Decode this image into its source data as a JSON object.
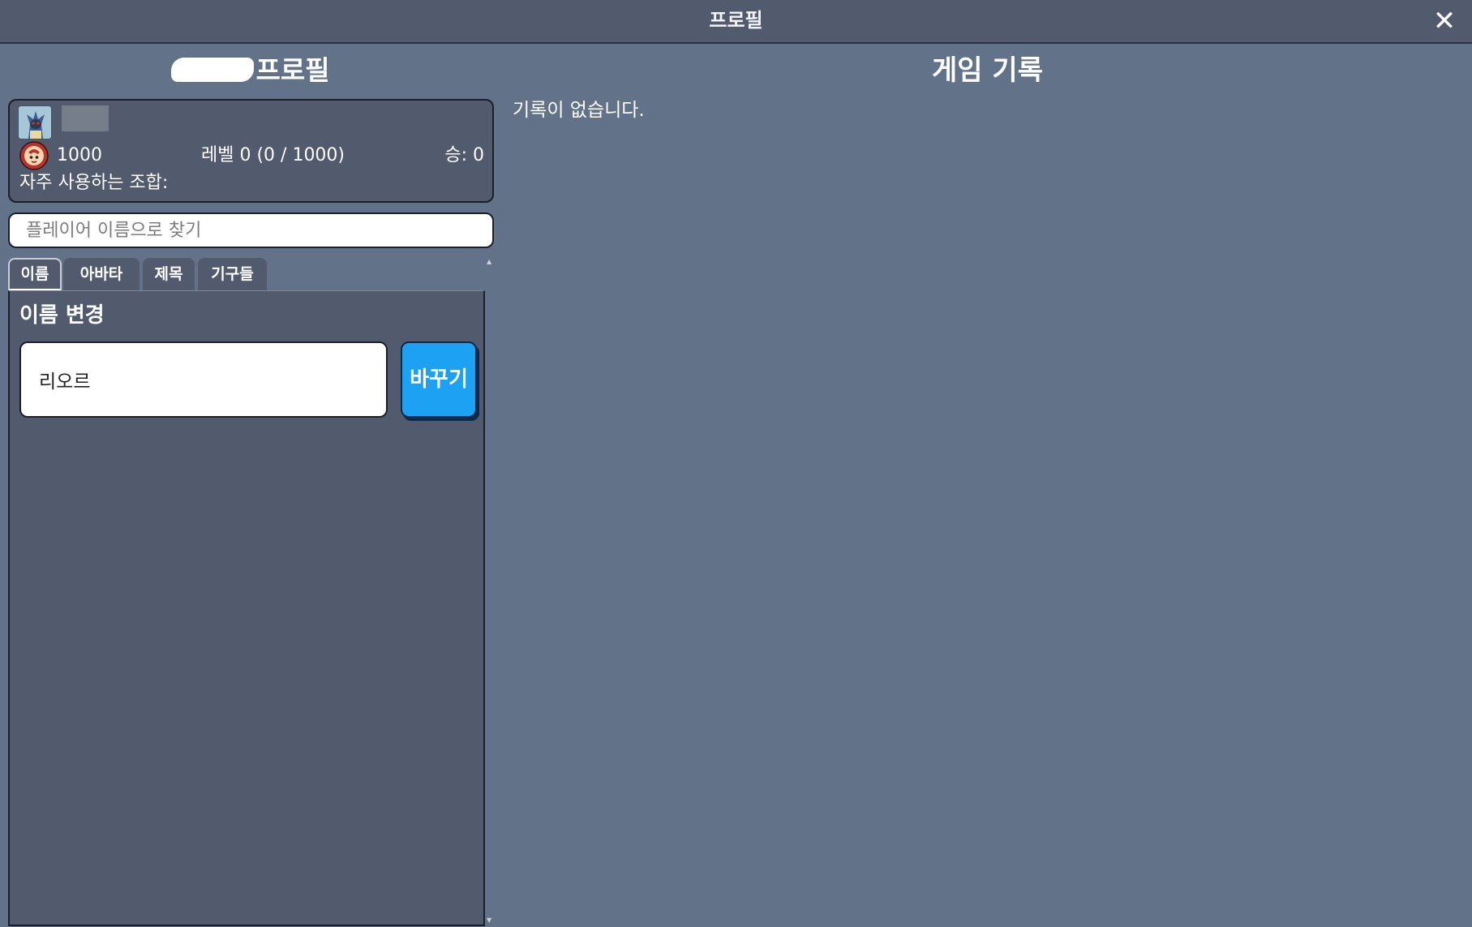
{
  "window": {
    "title": "프로필",
    "close_glyph": "✕"
  },
  "profile": {
    "heading_suffix": "프로필",
    "rating": "1000",
    "level_text": "레벨 0 (0 / 1000)",
    "wins_text": "승: 0",
    "combo_label": "자주 사용하는 조합:"
  },
  "search": {
    "placeholder": "플레이어 이름으로 찾기"
  },
  "tabs": [
    {
      "label": "이름"
    },
    {
      "label": "아바타"
    },
    {
      "label": "제목"
    },
    {
      "label": "기구들"
    }
  ],
  "name_panel": {
    "heading": "이름 변경",
    "input_value": "리오르",
    "button_label": "바꾸기"
  },
  "history": {
    "heading": "게임 기록",
    "empty_text": "기록이 없습니다."
  },
  "colors": {
    "background": "#627389",
    "panel": "#525a6e",
    "accent_button": "#1da1f2"
  }
}
